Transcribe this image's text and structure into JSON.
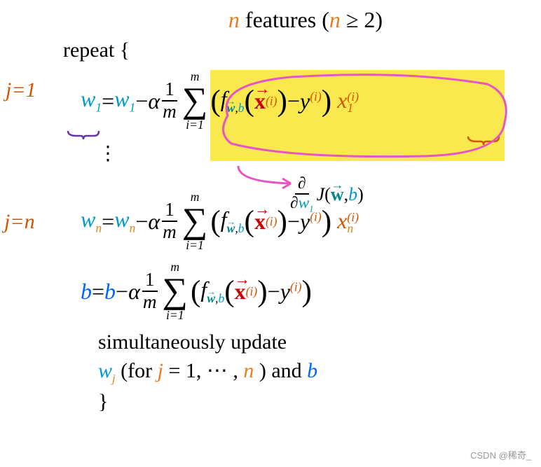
{
  "title": {
    "n1": "n",
    "feat": " features ",
    "cond": "(",
    "n2": "n",
    "ge": " ≥ 2)"
  },
  "repeat": "repeat {",
  "ann": {
    "j1": "j=1",
    "jn": "j=n"
  },
  "eq1": {
    "w": "w",
    "s1": "1",
    "eq": " = ",
    "wr": "w",
    "s1b": "1",
    "minus": " − ",
    "alpha": "α",
    "one": "1",
    "m": "m",
    "mtop": "m",
    "i1": "i=1",
    "f": "f",
    "wsub": "w",
    "comma": ",",
    "bsub": "b",
    "x": "x",
    "xi": "(i)",
    "my": " − ",
    "y": "y",
    "yi": "(i)",
    "xt": "x",
    "xsub1": "1",
    "xsup": "(i)"
  },
  "vdots": "⋮",
  "partial": {
    "d1": "∂",
    "d2": "∂",
    "w": "w",
    "s1": "1",
    "J": "J",
    "wv": "w",
    "c": ", ",
    "b": "b"
  },
  "eqn": {
    "w": "w",
    "sn": "n",
    "eq": " = ",
    "wr": "w",
    "snb": "n",
    "minus": " − ",
    "alpha": "α",
    "one": "1",
    "m": "m",
    "mtop": "m",
    "i1": "i=1",
    "f": "f",
    "wsub": "w",
    "comma": ",",
    "bsub": "b",
    "x": "x",
    "xi": "(i)",
    "my": " − ",
    "y": "y",
    "yi": "(i)",
    "xt": "x",
    "xsubn": "n",
    "xsup": "(i)"
  },
  "eqb": {
    "b": "b",
    "eq": " = ",
    "br": "b",
    "minus": " − ",
    "alpha": "α",
    "one": "1",
    "m": "m",
    "mtop": "m",
    "i1": "i=1",
    "f": "f",
    "wsub": "w",
    "comma": ",",
    "bsub": "b",
    "x": "x",
    "xi": "(i)",
    "my": " − ",
    "y": "y",
    "yi": "(i)"
  },
  "sim1": "simultaneously update",
  "sim2": {
    "w": "w",
    "j": "j",
    "for": " (for ",
    "jv": "j",
    "eq": " = 1, ⋯ , ",
    "n": "n",
    "and": ") and ",
    "b": "b"
  },
  "close": "}",
  "watermark": "CSDN @稀奇_"
}
